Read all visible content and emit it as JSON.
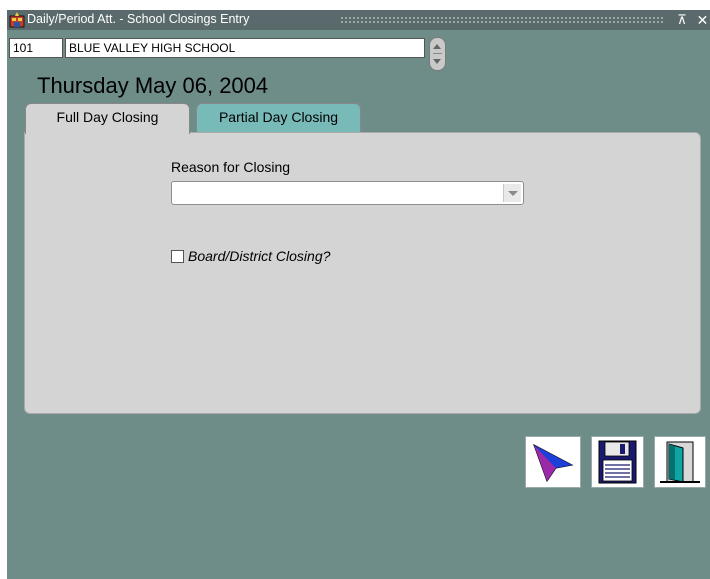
{
  "window": {
    "title": "Daily/Period Att. - School Closings Entry",
    "max_glyph": "⊼",
    "close_glyph": "✕"
  },
  "school": {
    "code": "101",
    "name": "BLUE VALLEY HIGH SCHOOL"
  },
  "date_heading": "Thursday  May 06, 2004",
  "tabs": [
    {
      "label": "Full Day Closing",
      "active": true
    },
    {
      "label": "Partial Day Closing",
      "active": false
    }
  ],
  "form": {
    "reason_label": "Reason for Closing",
    "reason_value": "",
    "board_closing_label": "Board/District Closing?",
    "board_closing_checked": false
  },
  "toolbar": {
    "select_icon": "arrow-cursor-icon",
    "save_icon": "floppy-disk-icon",
    "exit_icon": "exit-door-icon"
  },
  "colors": {
    "background": "#6e8c88",
    "panel": "#d4d4d4",
    "inactive_tab": "#78bab8",
    "titlebar": "#5a6a6c"
  }
}
